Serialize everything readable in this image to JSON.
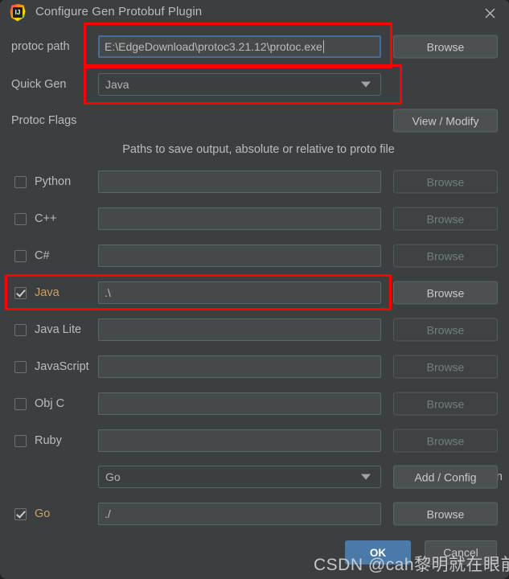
{
  "window": {
    "title": "Configure Gen Protobuf Plugin",
    "app_icon": "intellij-idea-icon",
    "close_icon": "close-icon"
  },
  "protoc_path": {
    "label": "protoc path",
    "value": "E:\\EdgeDownload\\protoc3.21.12\\protoc.exe",
    "browse_label": "Browse",
    "focused": true
  },
  "quick_gen": {
    "label": "Quick Gen",
    "value": "Java"
  },
  "protoc_flags": {
    "label": "Protoc Flags",
    "button_label": "View / Modify"
  },
  "paths_note": "Paths to save output, absolute or relative to proto file",
  "browse_label": "Browse",
  "languages": [
    {
      "name": "Python",
      "checked": false,
      "value": "",
      "browse_enabled": false
    },
    {
      "name": "C++",
      "checked": false,
      "value": "",
      "browse_enabled": false
    },
    {
      "name": "C#",
      "checked": false,
      "value": "",
      "browse_enabled": false
    },
    {
      "name": "Java",
      "checked": true,
      "value": ".\\",
      "browse_enabled": true
    },
    {
      "name": "Java Lite",
      "checked": false,
      "value": "",
      "browse_enabled": false
    },
    {
      "name": "JavaScript",
      "checked": false,
      "value": "",
      "browse_enabled": false
    },
    {
      "name": "Obj C",
      "checked": false,
      "value": "",
      "browse_enabled": false
    },
    {
      "name": "Ruby",
      "checked": false,
      "value": "",
      "browse_enabled": false
    }
  ],
  "plugin": {
    "label": "Plugin",
    "value": "Go",
    "button_label": "Add / Config"
  },
  "go": {
    "name": "Go",
    "checked": true,
    "value": "./",
    "browse_label": "Browse"
  },
  "footer": {
    "ok_label": "OK",
    "cancel_label": "Cancel"
  },
  "watermark": "CSDN @cah黎明就在眼前",
  "colors": {
    "dialog_bg": "#3c3f41",
    "field_bg": "#45494a",
    "accent_blue": "#4a7aa7",
    "focus_border": "#466d94",
    "annotation_red": "#fe0000",
    "modified_label": "#c9a066"
  }
}
